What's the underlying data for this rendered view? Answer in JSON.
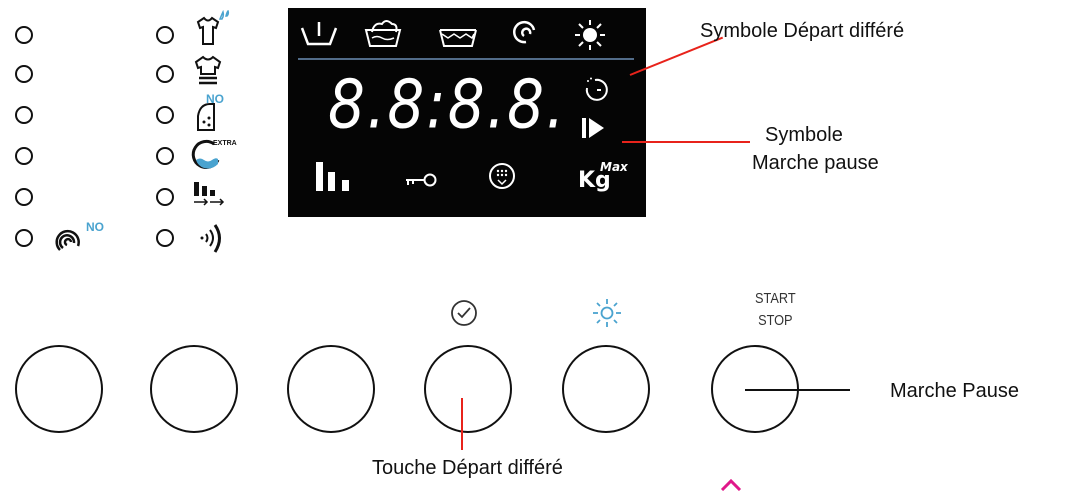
{
  "callouts": {
    "delayed_start_symbol": "Symbole Départ différé",
    "pause_symbol_line1": "Symbole",
    "pause_symbol_line2": "Marche pause",
    "pause_button": "Marche Pause",
    "delayed_start_button": "Touche Départ différé"
  },
  "display": {
    "digits": "8.8:8.8.",
    "kg": "Kg",
    "kg_max": "Max"
  },
  "icon_labels": {
    "no_iron": "NO",
    "no_spin": "NO",
    "extra_rinse": "EXTRA"
  },
  "buttons": {
    "start_stop_line1": "START",
    "start_stop_line2": "STOP"
  },
  "icons": {
    "left_column": [
      "spin-no-icon"
    ],
    "middle_column": [
      "easy-iron-shirt-icon",
      "shirt-icon",
      "no-iron-icon",
      "extra-rinse-icon",
      "spin-level-icon",
      "signal-icon"
    ],
    "display_top": [
      "prewash-icon",
      "wash-icon",
      "rinse-icon",
      "spin-icon",
      "sun-icon"
    ],
    "display_bottom": [
      "level-bars-icon",
      "child-lock-key-icon",
      "drain-icon",
      "kg-max-icon"
    ]
  },
  "colors": {
    "callout_line": "#e8231b",
    "accent_blue": "#4aa3cf",
    "display_bg": "#050505"
  }
}
